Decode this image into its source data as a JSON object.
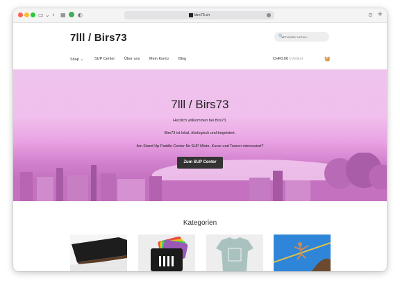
{
  "browser": {
    "url": "birs73.ch",
    "icons": [
      "sidebar-icon",
      "chevron-down-icon",
      "back-icon",
      "tab-overview-icon",
      "extension-icon",
      "privacy-icon",
      "download-icon",
      "new-tab-icon"
    ]
  },
  "site": {
    "logo": "7lll / Birs73",
    "search_placeholder": "Produkte suchen…",
    "nav": [
      "Shop",
      "SUP Center",
      "Über uns",
      "Mein Konto",
      "Blog"
    ],
    "cart_total": "CHF0.00",
    "cart_count": "0 Artikel"
  },
  "hero": {
    "title": "7lll / Birs73",
    "line1": "Herzlich willkommen bei Birs73.",
    "line2": "Birs73 ist lokal, ökologisch und begeistert.",
    "line3": "Am Stand Up Paddle Center für SUP Miete, Kurse und Touren interessiert?",
    "cta": "Zum SUP Center"
  },
  "categories": {
    "title": "Kategorien"
  },
  "colors": {
    "hero_tint": "#e6a5e3",
    "button": "#333333"
  }
}
